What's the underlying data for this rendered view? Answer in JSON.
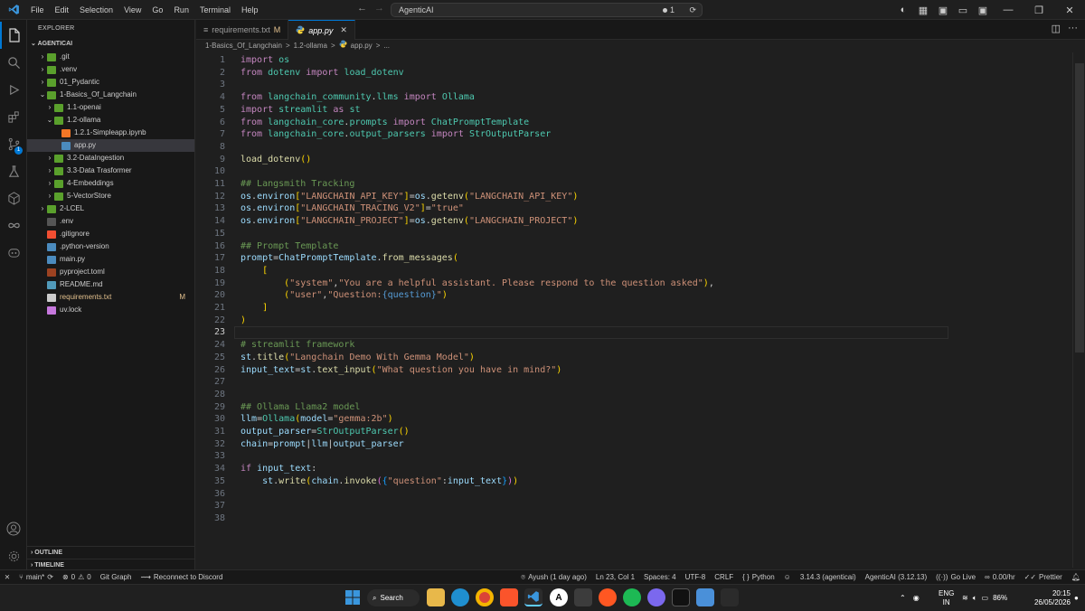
{
  "titlebar": {
    "menu": [
      "File",
      "Edit",
      "Selection",
      "View",
      "Go",
      "Run",
      "Terminal",
      "Help"
    ],
    "search": "AgenticAI",
    "count": "1"
  },
  "sidebar": {
    "title": "EXPLORER",
    "root": "AGENTICAI",
    "items": [
      {
        "label": ".git",
        "depth": 1,
        "kind": "folder",
        "open": false
      },
      {
        "label": ".venv",
        "depth": 1,
        "kind": "folder",
        "open": false
      },
      {
        "label": "01_Pydantic",
        "depth": 1,
        "kind": "folder",
        "open": false
      },
      {
        "label": "1-Basics_Of_Langchain",
        "depth": 1,
        "kind": "folder",
        "open": true
      },
      {
        "label": "1.1-openai",
        "depth": 2,
        "kind": "folder",
        "open": false
      },
      {
        "label": "1.2-ollama",
        "depth": 2,
        "kind": "folder",
        "open": true
      },
      {
        "label": "1.2.1-Simpleapp.ipynb",
        "depth": 3,
        "kind": "ipynb"
      },
      {
        "label": "app.py",
        "depth": 3,
        "kind": "py",
        "selected": true
      },
      {
        "label": "3.2-DataIngestion",
        "depth": 2,
        "kind": "folder",
        "open": false
      },
      {
        "label": "3.3-Data Trasformer",
        "depth": 2,
        "kind": "folder",
        "open": false
      },
      {
        "label": "4-Embeddings",
        "depth": 2,
        "kind": "folder",
        "open": false
      },
      {
        "label": "5-VectorStore",
        "depth": 2,
        "kind": "folder",
        "open": false
      },
      {
        "label": "2-LCEL",
        "depth": 1,
        "kind": "folder",
        "open": false
      },
      {
        "label": ".env",
        "depth": 1,
        "kind": "env"
      },
      {
        "label": ".gitignore",
        "depth": 1,
        "kind": "git"
      },
      {
        "label": ".python-version",
        "depth": 1,
        "kind": "pyver"
      },
      {
        "label": "main.py",
        "depth": 1,
        "kind": "py"
      },
      {
        "label": "pyproject.toml",
        "depth": 1,
        "kind": "toml"
      },
      {
        "label": "README.md",
        "depth": 1,
        "kind": "md"
      },
      {
        "label": "requirements.txt",
        "depth": 1,
        "kind": "txt",
        "badge": "M"
      },
      {
        "label": "uv.lock",
        "depth": 1,
        "kind": "lock"
      }
    ],
    "outline": "OUTLINE",
    "timeline": "TIMELINE"
  },
  "tabs": [
    {
      "label": "requirements.txt",
      "badge": "M"
    },
    {
      "label": "app.py",
      "active": true
    }
  ],
  "breadcrumb": [
    "1-Basics_Of_Langchain",
    ">",
    "1.2-ollama",
    ">",
    "app.py",
    ">",
    "..."
  ],
  "code": [
    "import os",
    "from dotenv import load_dotenv",
    "",
    "from langchain_community.llms import Ollama",
    "import streamlit as st",
    "from langchain_core.prompts import ChatPromptTemplate",
    "from langchain_core.output_parsers import StrOutputParser",
    "",
    "load_dotenv()",
    "",
    "## Langsmith Tracking",
    "os.environ[\"LANGCHAIN_API_KEY\"]=os.getenv(\"LANGCHAIN_API_KEY\")",
    "os.environ[\"LANGCHAIN_TRACING_V2\"]=\"true\"",
    "os.environ[\"LANGCHAIN_PROJECT\"]=os.getenv(\"LANGCHAIN_PROJECT\")",
    "",
    "## Prompt Template",
    "prompt=ChatPromptTemplate.from_messages(",
    "    [",
    "        (\"system\",\"You are a helpful assistant. Please respond to the question asked\"),",
    "        (\"user\",\"Question:{question}\")",
    "    ]",
    ")",
    "",
    "# streamlit framework",
    "st.title(\"Langchain Demo With Gemma Model\")",
    "input_text=st.text_input(\"What question you have in mind?\")",
    "",
    "",
    "## Ollama Llama2 model",
    "llm=Ollama(model=\"gemma:2b\")",
    "output_parser=StrOutputParser()",
    "chain=prompt|llm|output_parser",
    "",
    "if input_text:",
    "    st.write(chain.invoke({\"question\":input_text}))",
    "",
    "",
    ""
  ],
  "current_line": 23,
  "status": {
    "branch": "main*",
    "errors": "0",
    "warnings": "0",
    "git_graph": "Git Graph",
    "discord": "Reconnect to Discord",
    "blame": "Ayush (1 day ago)",
    "position": "Ln 23, Col 1",
    "spaces": "Spaces: 4",
    "encoding": "UTF-8",
    "eol": "CRLF",
    "language": "Python",
    "python_ver": "3.14.3 (agenticai)",
    "env": "AgenticAI (3.12.13)",
    "golive": "Go Live",
    "rate": "0.00/hr",
    "prettier": "Prettier"
  },
  "taskbar": {
    "search": "Search",
    "lang": "ENG",
    "region": "IN",
    "battery": "86%",
    "time": "20:15",
    "date": "26/05/2026"
  }
}
